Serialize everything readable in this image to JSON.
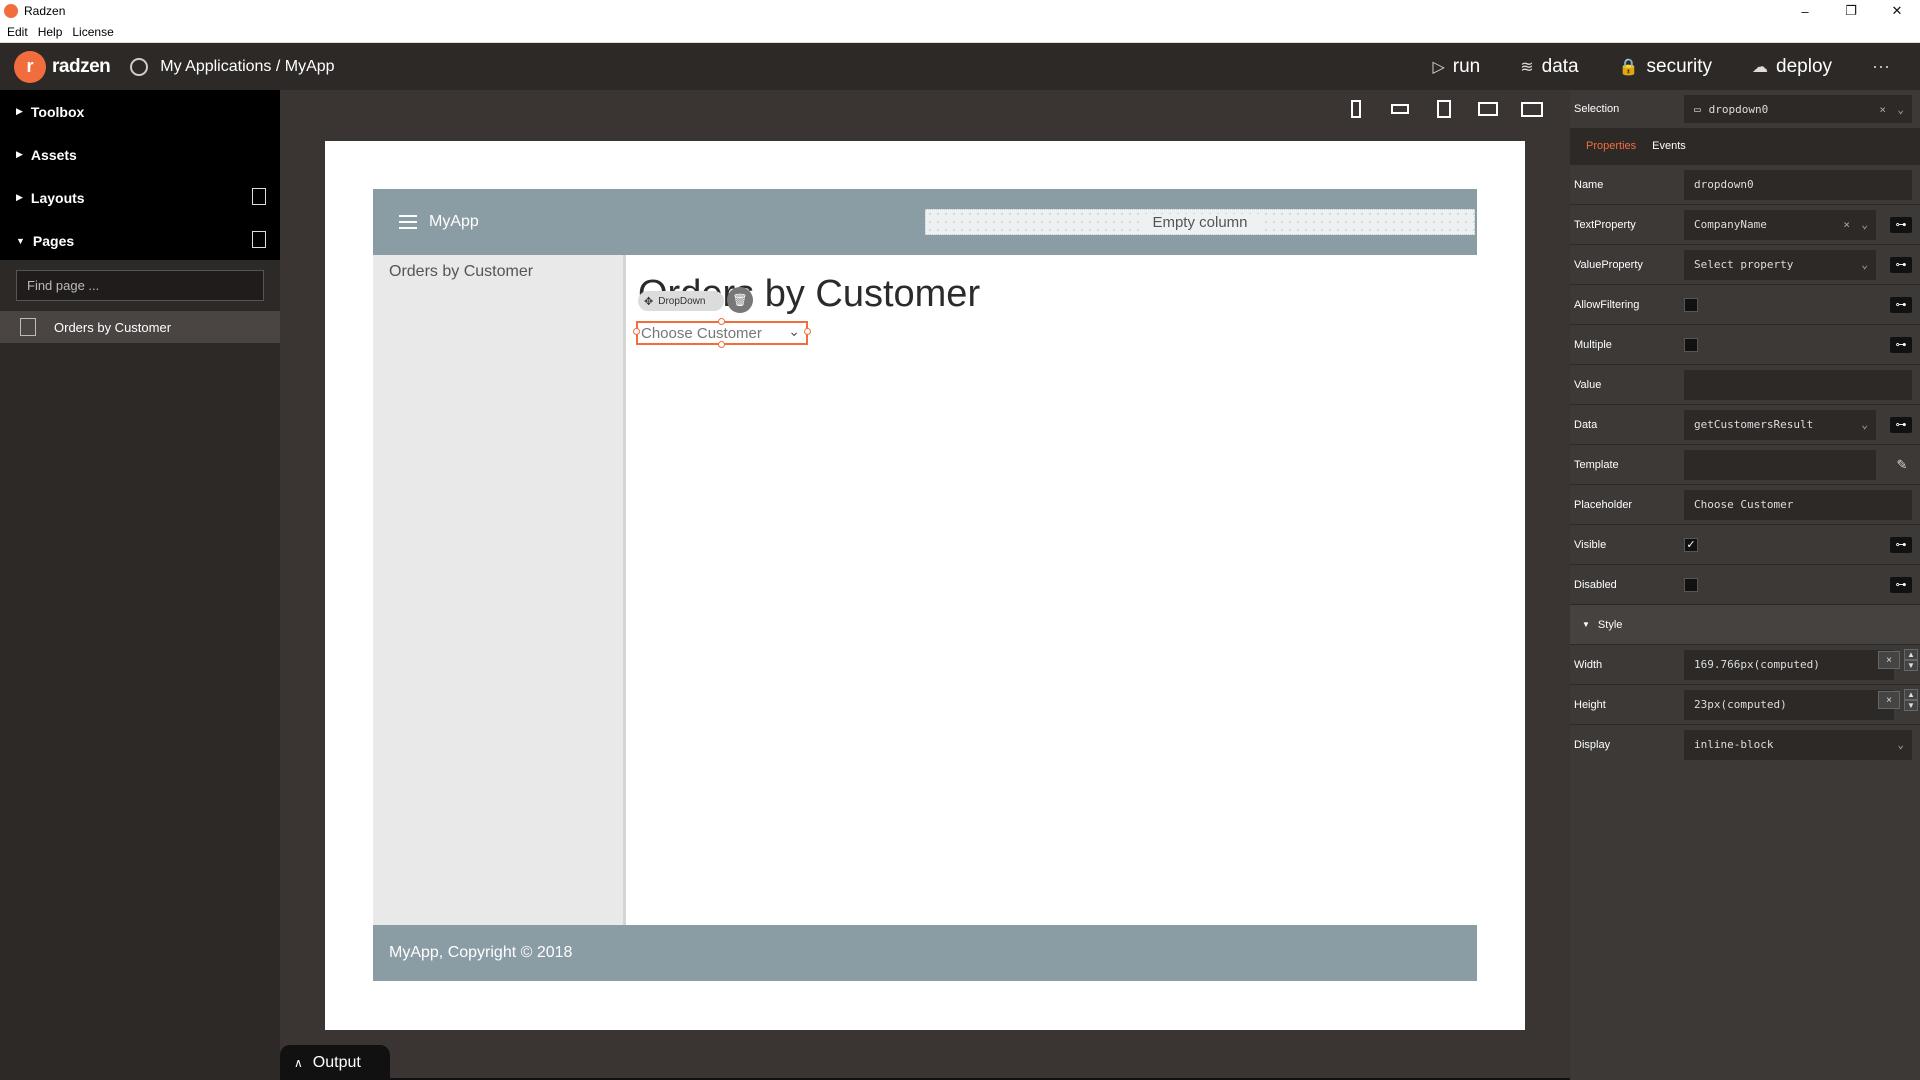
{
  "window": {
    "title": "Radzen",
    "minimize": "–",
    "maximize": "❐",
    "close": "✕"
  },
  "menu": [
    "Edit",
    "Help",
    "License"
  ],
  "header": {
    "logo_text": "radzen",
    "app_path": "My Applications / MyApp",
    "nav": [
      {
        "label": "run",
        "icon": "▷"
      },
      {
        "label": "data",
        "icon": "≋"
      },
      {
        "label": "security",
        "icon": "🔒"
      },
      {
        "label": "deploy",
        "icon": "☁"
      }
    ],
    "more": "···"
  },
  "sidebar": {
    "sections": [
      {
        "label": "Toolbox",
        "expanded": false
      },
      {
        "label": "Assets",
        "expanded": false
      },
      {
        "label": "Layouts",
        "expanded": false
      },
      {
        "label": "Pages",
        "expanded": true
      }
    ],
    "find_placeholder": "Find page ...",
    "pages": [
      "Orders by Customer"
    ]
  },
  "canvas": {
    "app_brand": "MyApp",
    "empty_column": "Empty column",
    "side_link": "Orders by Customer",
    "page_title": "Orders by Customer",
    "component_badge": "DropDown",
    "dropdown_placeholder": "Choose Customer",
    "footer": "MyApp, Copyright © 2018"
  },
  "output": {
    "label": "Output"
  },
  "properties": {
    "selection_label": "Selection",
    "selection_value": "dropdown0",
    "tabs": [
      {
        "label": "Properties",
        "active": true
      },
      {
        "label": "Events",
        "active": false
      }
    ],
    "name": {
      "label": "Name",
      "value": "dropdown0"
    },
    "text_property": {
      "label": "TextProperty",
      "value": "CompanyName"
    },
    "value_property": {
      "label": "ValueProperty",
      "value": "Select property"
    },
    "allow_filtering": {
      "label": "AllowFiltering",
      "checked": false
    },
    "multiple": {
      "label": "Multiple",
      "checked": false
    },
    "value": {
      "label": "Value",
      "value": ""
    },
    "data": {
      "label": "Data",
      "value": "getCustomersResult"
    },
    "template": {
      "label": "Template",
      "value": ""
    },
    "placeholder": {
      "label": "Placeholder",
      "value": "Choose Customer"
    },
    "visible": {
      "label": "Visible",
      "checked": true
    },
    "disabled": {
      "label": "Disabled",
      "checked": false
    },
    "style_label": "Style",
    "width": {
      "label": "Width",
      "value": "169.766px(computed)"
    },
    "height": {
      "label": "Height",
      "value": "23px(computed)"
    },
    "display": {
      "label": "Display",
      "value": "inline-block"
    }
  },
  "colors": {
    "accent": "#f26d3d",
    "app_header": "#8a9ca4",
    "panel": "#3d3937"
  }
}
